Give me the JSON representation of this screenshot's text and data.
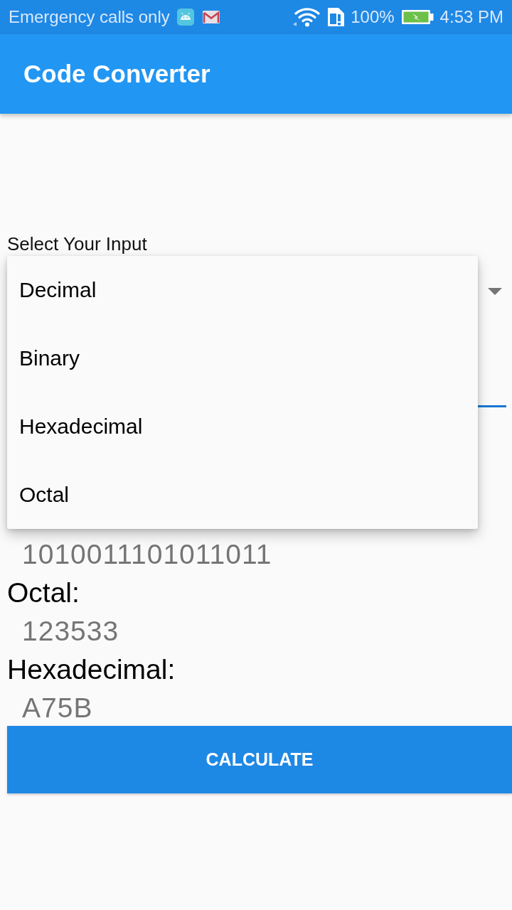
{
  "status_bar": {
    "carrier": "Emergency calls only",
    "battery": "100%",
    "time": "4:53 PM"
  },
  "app_bar": {
    "title": "Code Converter"
  },
  "input_label": "Select Your Input",
  "dropdown": {
    "expanded": true,
    "options": [
      "Decimal",
      "Binary",
      "Hexadecimal",
      "Octal"
    ]
  },
  "results": [
    {
      "value": "1010011101011011"
    },
    {
      "label": "Octal:",
      "value": "123533"
    },
    {
      "label": "Hexadecimal:",
      "value": "A75B"
    }
  ],
  "calculate_button": "CALCULATE"
}
